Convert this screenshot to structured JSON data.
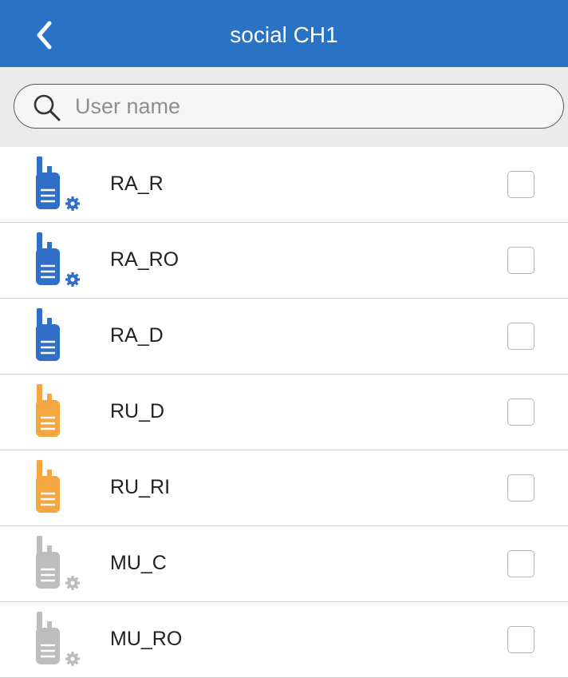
{
  "header": {
    "title": "social CH1",
    "back_icon": "chevron-left-icon",
    "background_color": "#2a73c4"
  },
  "search": {
    "placeholder": "User name",
    "value": "",
    "icon": "search-icon"
  },
  "colors": {
    "blue": "#2f6fc7",
    "orange": "#f4a640",
    "gray": "#bdbdbd"
  },
  "users": [
    {
      "name": "RA_R",
      "icon": "radio-gear-icon",
      "color": "blue",
      "gear": true,
      "checked": false
    },
    {
      "name": "RA_RO",
      "icon": "radio-gear-icon",
      "color": "blue",
      "gear": true,
      "checked": false
    },
    {
      "name": "RA_D",
      "icon": "radio-icon",
      "color": "blue",
      "gear": false,
      "checked": false
    },
    {
      "name": "RU_D",
      "icon": "radio-icon",
      "color": "orange",
      "gear": false,
      "checked": false
    },
    {
      "name": "RU_RI",
      "icon": "radio-icon",
      "color": "orange",
      "gear": false,
      "checked": false
    },
    {
      "name": "MU_C",
      "icon": "radio-gear-icon",
      "color": "gray",
      "gear": true,
      "checked": false
    },
    {
      "name": "MU_RO",
      "icon": "radio-gear-icon",
      "color": "gray",
      "gear": true,
      "checked": false
    }
  ]
}
